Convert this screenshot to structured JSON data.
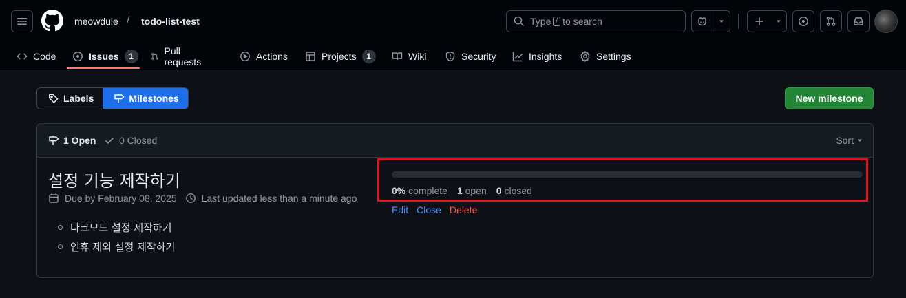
{
  "header": {
    "owner": "meowdule",
    "separator": "/",
    "repo": "todo-list-test",
    "search": {
      "prefix": "Type",
      "key": "/",
      "suffix": "to search"
    }
  },
  "tabs": [
    {
      "label": "Code",
      "icon": "code-icon"
    },
    {
      "label": "Issues",
      "icon": "issue-opened-icon",
      "count": "1",
      "selected": true
    },
    {
      "label": "Pull requests",
      "icon": "git-pull-request-icon"
    },
    {
      "label": "Actions",
      "icon": "play-icon"
    },
    {
      "label": "Projects",
      "icon": "table-icon",
      "count": "1"
    },
    {
      "label": "Wiki",
      "icon": "book-icon"
    },
    {
      "label": "Security",
      "icon": "shield-icon"
    },
    {
      "label": "Insights",
      "icon": "graph-icon"
    },
    {
      "label": "Settings",
      "icon": "gear-icon"
    }
  ],
  "subnav": {
    "labels": "Labels",
    "milestones": "Milestones",
    "new_milestone": "New milestone"
  },
  "list_header": {
    "open": "1 Open",
    "closed": "0 Closed",
    "sort": "Sort"
  },
  "milestone": {
    "title": "설정 기능 제작하기",
    "due": "Due by February 08, 2025",
    "updated": "Last updated less than a minute ago",
    "description": [
      "다크모드 설정 제작하기",
      "연휴 제외 설정 제작하기"
    ],
    "progress_percent": 0,
    "percent_label": "0%",
    "complete_label": "complete",
    "open_count": "1",
    "open_label": "open",
    "closed_count": "0",
    "closed_label": "closed",
    "actions": {
      "edit": "Edit",
      "close": "Close",
      "delete": "Delete"
    }
  },
  "colors": {
    "accent": "#1f6feb",
    "primary_button": "#238636",
    "danger": "#f85149",
    "highlight_box": "#e3141b",
    "tab_underline": "#f78166"
  }
}
